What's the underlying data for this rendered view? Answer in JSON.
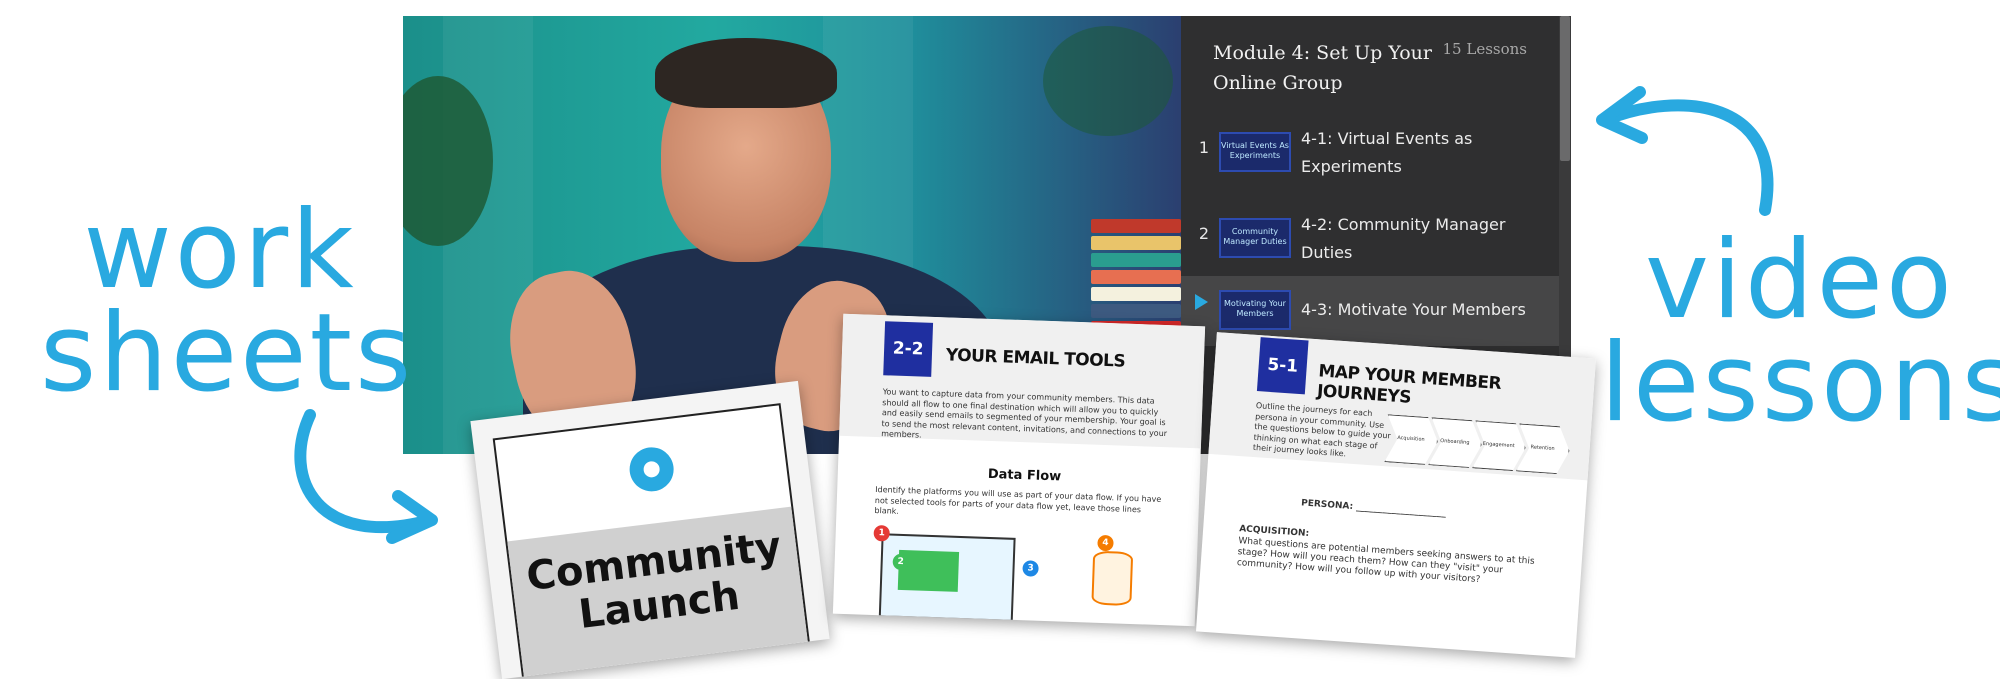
{
  "labels": {
    "worksheets_line1": "work",
    "worksheets_line2": "sheets",
    "video_line1": "video",
    "video_line2": "lessons"
  },
  "colors": {
    "accent": "#29a9e0",
    "sidebar_bg": "#2f2f30",
    "active_row": "#464647",
    "worksheet_blue": "#1f2fa0"
  },
  "sidebar": {
    "module_title": "Module 4: Set Up Your Online Group",
    "lesson_count": "15 Lessons",
    "lessons": [
      {
        "num": "1",
        "title": "4-1: Virtual Events as Experiments",
        "thumb": "Virtual Events As Experiments",
        "active": false
      },
      {
        "num": "2",
        "title": "4-2: Community Manager Duties",
        "thumb": "Community Manager Duties",
        "active": false
      },
      {
        "num": "",
        "title": "4-3: Motivate Your Members",
        "thumb": "Motivating Your Members",
        "active": true
      }
    ]
  },
  "worksheets": {
    "cover": {
      "title_line1": "Community",
      "title_line2": "Launch"
    },
    "email": {
      "number": "2-2",
      "title": "YOUR EMAIL TOOLS",
      "intro": "You want to capture data from your community members. This data should all flow to one final destination which will allow you to quickly and easily send emails to segmented of your membership. Your goal is to send the most relevant content, invitations, and connections to your members.",
      "subhead": "Data Flow",
      "body": "Identify the platforms you will use as part of your data flow. If you have not selected tools for parts of your data flow yet, leave those lines blank.",
      "flow_steps": [
        "1",
        "2",
        "3",
        "4"
      ]
    },
    "journey": {
      "number": "5-1",
      "title": "MAP YOUR MEMBER JOURNEYS",
      "intro": "Outline the journeys for each persona in your community. Use the questions below to guide your thinking on what each stage of their journey looks like.",
      "stages": [
        "Acquisition",
        "Onboarding",
        "Engagement",
        "Retention"
      ],
      "persona_label": "PERSONA: ____________________",
      "acquisition_label": "ACQUISITION:",
      "acquisition_text": "What questions are potential members seeking answers to at this stage? How will you reach them? How can they \"visit\" your community? How will you follow up with your visitors?"
    }
  }
}
